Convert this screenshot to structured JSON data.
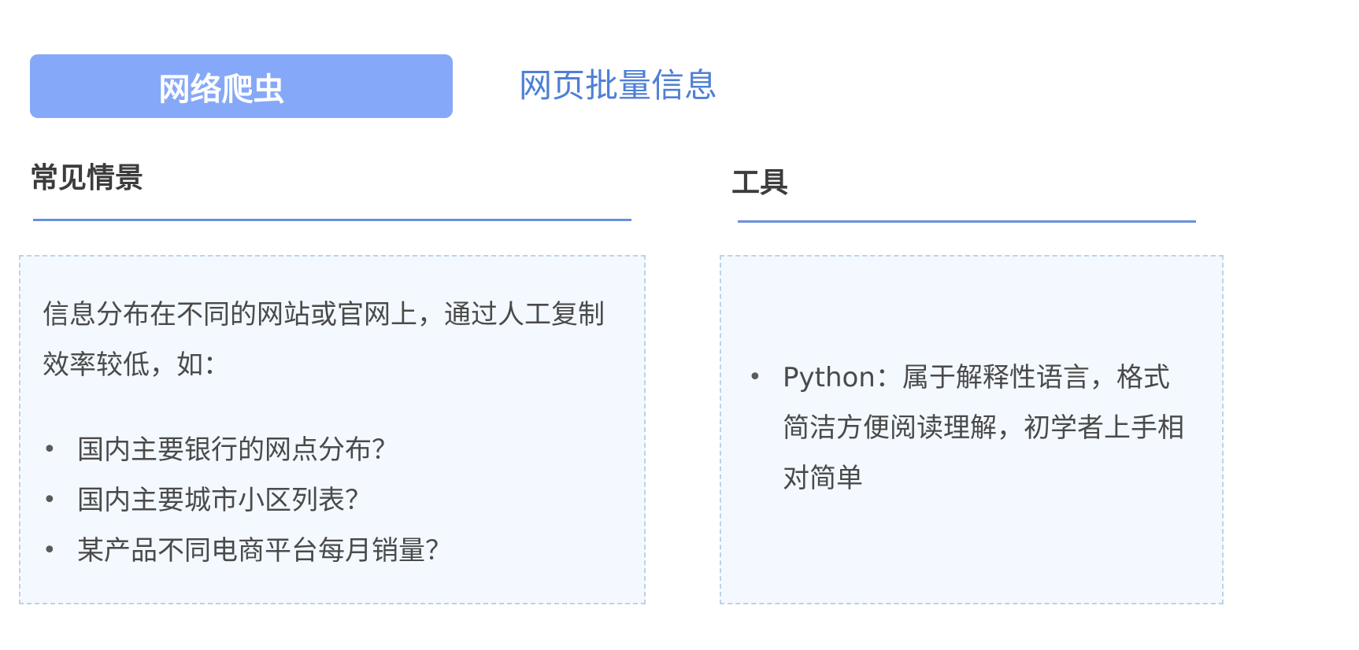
{
  "header": {
    "tag_label": "网络爬虫",
    "subtitle": "网页批量信息"
  },
  "left": {
    "title": "常见情景",
    "paragraph": "信息分布在不同的网站或官网上，通过人工复制效率较低，如：",
    "items": [
      "国内主要银行的网点分布？",
      "国内主要城市小区列表？",
      "某产品不同电商平台每月销量？"
    ]
  },
  "right": {
    "title": "工具",
    "items": [
      "Python：属于解释性语言，格式简洁方便阅读理解，初学者上手相对简单"
    ]
  },
  "colors": {
    "tag_bg": "#86a8f8",
    "accent": "#4f7fd6",
    "rule": "#6b8fdc",
    "panel_bg": "#f3f9ff",
    "panel_border": "#bfd2e6"
  }
}
